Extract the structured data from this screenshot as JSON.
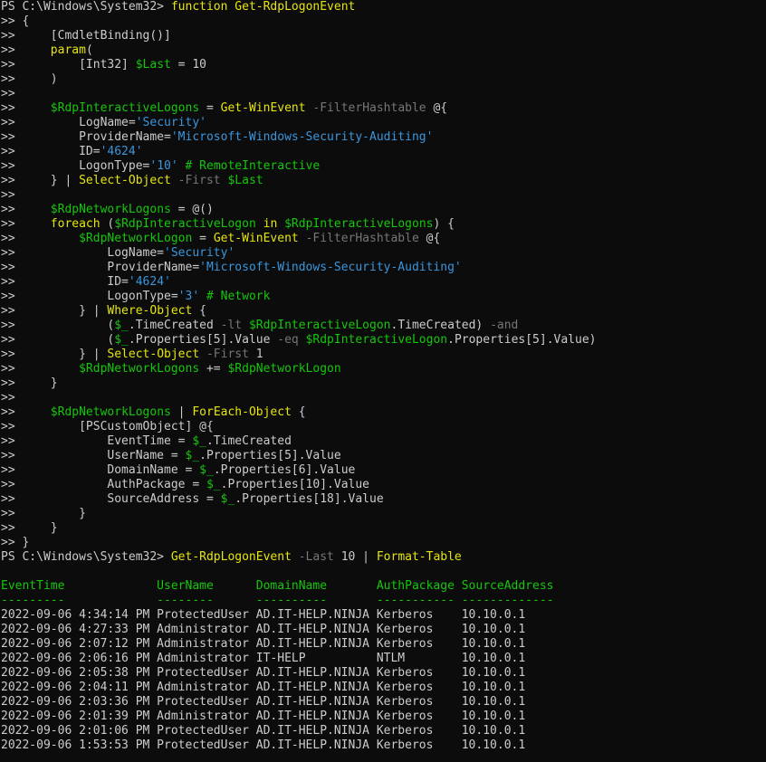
{
  "window": {
    "background": "#0c0c0c",
    "colors": {
      "default": "#cccccc",
      "cmdlet_keyword": "#e5e510",
      "variable": "#16c60c",
      "string": "#3a96dd",
      "parameter": "#767676",
      "comment": "#16c60c",
      "table_header": "#16c60c"
    }
  },
  "lines": [
    [
      [
        "d",
        "PS C:\\Windows\\System32> "
      ],
      [
        "k",
        "function"
      ],
      [
        "d",
        " "
      ],
      [
        "k",
        "Get-RdpLogonEvent"
      ]
    ],
    [
      [
        "d",
        ">> {"
      ]
    ],
    [
      [
        "d",
        ">>     [CmdletBinding()]"
      ]
    ],
    [
      [
        "d",
        ">>     "
      ],
      [
        "k",
        "param"
      ],
      [
        "d",
        "("
      ]
    ],
    [
      [
        "d",
        ">>         [Int32] "
      ],
      [
        "v",
        "$Last"
      ],
      [
        "d",
        " = 10"
      ]
    ],
    [
      [
        "d",
        ">>     )"
      ]
    ],
    [
      [
        "d",
        ">>"
      ]
    ],
    [
      [
        "d",
        ">>     "
      ],
      [
        "v",
        "$RdpInteractiveLogons"
      ],
      [
        "d",
        " = "
      ],
      [
        "k",
        "Get-WinEvent"
      ],
      [
        "d",
        " "
      ],
      [
        "p",
        "-FilterHashtable"
      ],
      [
        "d",
        " @{"
      ]
    ],
    [
      [
        "d",
        ">>         LogName="
      ],
      [
        "s",
        "'Security'"
      ]
    ],
    [
      [
        "d",
        ">>         ProviderName="
      ],
      [
        "s",
        "'Microsoft-Windows-Security-Auditing'"
      ]
    ],
    [
      [
        "d",
        ">>         ID="
      ],
      [
        "s",
        "'4624'"
      ]
    ],
    [
      [
        "d",
        ">>         LogonType="
      ],
      [
        "s",
        "'10'"
      ],
      [
        "d",
        " "
      ],
      [
        "c",
        "# RemoteInteractive"
      ]
    ],
    [
      [
        "d",
        ">>     } | "
      ],
      [
        "k",
        "Select-Object"
      ],
      [
        "d",
        " "
      ],
      [
        "p",
        "-First"
      ],
      [
        "d",
        " "
      ],
      [
        "v",
        "$Last"
      ]
    ],
    [
      [
        "d",
        ">>"
      ]
    ],
    [
      [
        "d",
        ">>     "
      ],
      [
        "v",
        "$RdpNetworkLogons"
      ],
      [
        "d",
        " = @()"
      ]
    ],
    [
      [
        "d",
        ">>     "
      ],
      [
        "k",
        "foreach"
      ],
      [
        "d",
        " ("
      ],
      [
        "v",
        "$RdpInteractiveLogon"
      ],
      [
        "d",
        " "
      ],
      [
        "k",
        "in"
      ],
      [
        "d",
        " "
      ],
      [
        "v",
        "$RdpInteractiveLogons"
      ],
      [
        "d",
        ") {"
      ]
    ],
    [
      [
        "d",
        ">>         "
      ],
      [
        "v",
        "$RdpNetworkLogon"
      ],
      [
        "d",
        " = "
      ],
      [
        "k",
        "Get-WinEvent"
      ],
      [
        "d",
        " "
      ],
      [
        "p",
        "-FilterHashtable"
      ],
      [
        "d",
        " @{"
      ]
    ],
    [
      [
        "d",
        ">>             LogName="
      ],
      [
        "s",
        "'Security'"
      ]
    ],
    [
      [
        "d",
        ">>             ProviderName="
      ],
      [
        "s",
        "'Microsoft-Windows-Security-Auditing'"
      ]
    ],
    [
      [
        "d",
        ">>             ID="
      ],
      [
        "s",
        "'4624'"
      ]
    ],
    [
      [
        "d",
        ">>             LogonType="
      ],
      [
        "s",
        "'3'"
      ],
      [
        "d",
        " "
      ],
      [
        "c",
        "# Network"
      ]
    ],
    [
      [
        "d",
        ">>         } | "
      ],
      [
        "k",
        "Where-Object"
      ],
      [
        "d",
        " {"
      ]
    ],
    [
      [
        "d",
        ">>             ("
      ],
      [
        "v",
        "$_"
      ],
      [
        "d",
        ".TimeCreated "
      ],
      [
        "p",
        "-lt"
      ],
      [
        "d",
        " "
      ],
      [
        "v",
        "$RdpInteractiveLogon"
      ],
      [
        "d",
        ".TimeCreated) "
      ],
      [
        "p",
        "-and"
      ]
    ],
    [
      [
        "d",
        ">>             ("
      ],
      [
        "v",
        "$_"
      ],
      [
        "d",
        ".Properties[5].Value "
      ],
      [
        "p",
        "-eq"
      ],
      [
        "d",
        " "
      ],
      [
        "v",
        "$RdpInteractiveLogon"
      ],
      [
        "d",
        ".Properties[5].Value)"
      ]
    ],
    [
      [
        "d",
        ">>         } | "
      ],
      [
        "k",
        "Select-Object"
      ],
      [
        "d",
        " "
      ],
      [
        "p",
        "-First"
      ],
      [
        "d",
        " 1"
      ]
    ],
    [
      [
        "d",
        ">>         "
      ],
      [
        "v",
        "$RdpNetworkLogons"
      ],
      [
        "d",
        " += "
      ],
      [
        "v",
        "$RdpNetworkLogon"
      ]
    ],
    [
      [
        "d",
        ">>     }"
      ]
    ],
    [
      [
        "d",
        ">>"
      ]
    ],
    [
      [
        "d",
        ">>     "
      ],
      [
        "v",
        "$RdpNetworkLogons"
      ],
      [
        "d",
        " | "
      ],
      [
        "k",
        "ForEach-Object"
      ],
      [
        "d",
        " {"
      ]
    ],
    [
      [
        "d",
        ">>         [PSCustomObject] @{"
      ]
    ],
    [
      [
        "d",
        ">>             EventTime = "
      ],
      [
        "v",
        "$_"
      ],
      [
        "d",
        ".TimeCreated"
      ]
    ],
    [
      [
        "d",
        ">>             UserName = "
      ],
      [
        "v",
        "$_"
      ],
      [
        "d",
        ".Properties[5].Value"
      ]
    ],
    [
      [
        "d",
        ">>             DomainName = "
      ],
      [
        "v",
        "$_"
      ],
      [
        "d",
        ".Properties[6].Value"
      ]
    ],
    [
      [
        "d",
        ">>             AuthPackage = "
      ],
      [
        "v",
        "$_"
      ],
      [
        "d",
        ".Properties[10].Value"
      ]
    ],
    [
      [
        "d",
        ">>             SourceAddress = "
      ],
      [
        "v",
        "$_"
      ],
      [
        "d",
        ".Properties[18].Value"
      ]
    ],
    [
      [
        "d",
        ">>         }"
      ]
    ],
    [
      [
        "d",
        ">>     }"
      ]
    ],
    [
      [
        "d",
        ">> }"
      ]
    ],
    [
      [
        "d",
        "PS C:\\Windows\\System32> "
      ],
      [
        "k",
        "Get-RdpLogonEvent"
      ],
      [
        "d",
        " "
      ],
      [
        "p",
        "-Last"
      ],
      [
        "d",
        " 10 | "
      ],
      [
        "k",
        "Format-Table"
      ]
    ],
    [
      [
        "d",
        ""
      ]
    ],
    [
      [
        "h",
        "EventTime             UserName      DomainName       AuthPackage SourceAddress"
      ]
    ],
    [
      [
        "h",
        "---------             --------      ----------       ----------- -------------"
      ]
    ],
    [
      [
        "d",
        "2022-09-06 4:34:14 PM ProtectedUser AD.IT-HELP.NINJA Kerberos    10.10.0.1"
      ]
    ],
    [
      [
        "d",
        "2022-09-06 4:27:33 PM Administrator AD.IT-HELP.NINJA Kerberos    10.10.0.1"
      ]
    ],
    [
      [
        "d",
        "2022-09-06 2:07:12 PM Administrator AD.IT-HELP.NINJA Kerberos    10.10.0.1"
      ]
    ],
    [
      [
        "d",
        "2022-09-06 2:06:16 PM Administrator IT-HELP          NTLM        10.10.0.1"
      ]
    ],
    [
      [
        "d",
        "2022-09-06 2:05:38 PM ProtectedUser AD.IT-HELP.NINJA Kerberos    10.10.0.1"
      ]
    ],
    [
      [
        "d",
        "2022-09-06 2:04:11 PM Administrator AD.IT-HELP.NINJA Kerberos    10.10.0.1"
      ]
    ],
    [
      [
        "d",
        "2022-09-06 2:03:36 PM ProtectedUser AD.IT-HELP.NINJA Kerberos    10.10.0.1"
      ]
    ],
    [
      [
        "d",
        "2022-09-06 2:01:39 PM Administrator AD.IT-HELP.NINJA Kerberos    10.10.0.1"
      ]
    ],
    [
      [
        "d",
        "2022-09-06 2:01:06 PM ProtectedUser AD.IT-HELP.NINJA Kerberos    10.10.0.1"
      ]
    ],
    [
      [
        "d",
        "2022-09-06 1:53:53 PM ProtectedUser AD.IT-HELP.NINJA Kerberos    10.10.0.1"
      ]
    ]
  ]
}
